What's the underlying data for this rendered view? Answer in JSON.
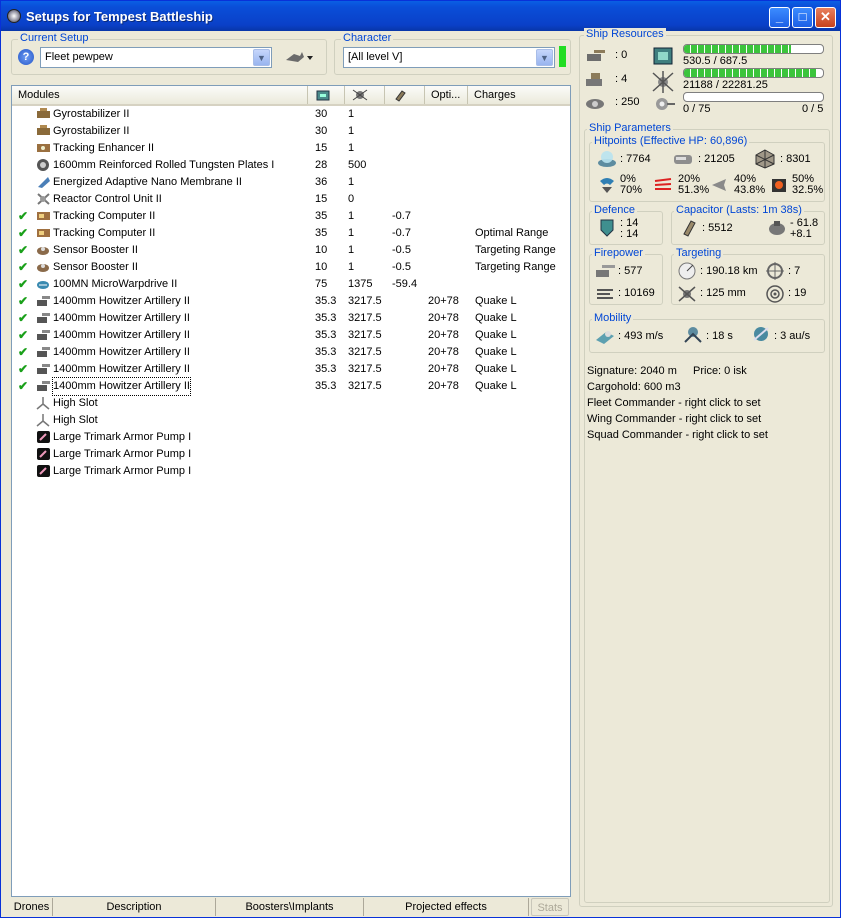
{
  "window": {
    "title": "Setups for Tempest Battleship"
  },
  "current_setup": {
    "label": "Current Setup",
    "value": "Fleet pewpew"
  },
  "character": {
    "label": "Character",
    "value": "[All level V]"
  },
  "modules": {
    "headers": [
      "Modules",
      "",
      "",
      "",
      "Opti...",
      "Charges"
    ],
    "rows": [
      {
        "check": false,
        "icon": "gyrostabilizer-icon",
        "name": "Gyrostabilizer II",
        "c1": "30",
        "c2": "1",
        "c3": "",
        "c4": "",
        "c5": ""
      },
      {
        "check": false,
        "icon": "gyrostabilizer-icon",
        "name": "Gyrostabilizer II",
        "c1": "30",
        "c2": "1",
        "c3": "",
        "c4": "",
        "c5": ""
      },
      {
        "check": false,
        "icon": "tracking-enhancer-icon",
        "name": "Tracking Enhancer II",
        "c1": "15",
        "c2": "1",
        "c3": "",
        "c4": "",
        "c5": ""
      },
      {
        "check": false,
        "icon": "armor-plate-icon",
        "name": "1600mm Reinforced Rolled Tungsten Plates I",
        "c1": "28",
        "c2": "500",
        "c3": "",
        "c4": "",
        "c5": ""
      },
      {
        "check": false,
        "icon": "membrane-icon",
        "name": "Energized Adaptive Nano Membrane II",
        "c1": "36",
        "c2": "1",
        "c3": "",
        "c4": "",
        "c5": ""
      },
      {
        "check": false,
        "icon": "reactor-icon",
        "name": "Reactor Control Unit II",
        "c1": "15",
        "c2": "0",
        "c3": "",
        "c4": "",
        "c5": ""
      },
      {
        "check": true,
        "icon": "tracking-computer-icon",
        "name": "Tracking Computer II",
        "c1": "35",
        "c2": "1",
        "c3": "-0.7",
        "c4": "",
        "c5": ""
      },
      {
        "check": true,
        "icon": "tracking-computer-icon",
        "name": "Tracking Computer II",
        "c1": "35",
        "c2": "1",
        "c3": "-0.7",
        "c4": "",
        "c5": "Optimal Range"
      },
      {
        "check": true,
        "icon": "sensor-booster-icon",
        "name": "Sensor Booster II",
        "c1": "10",
        "c2": "1",
        "c3": "-0.5",
        "c4": "",
        "c5": "Targeting Range"
      },
      {
        "check": true,
        "icon": "sensor-booster-icon",
        "name": "Sensor Booster II",
        "c1": "10",
        "c2": "1",
        "c3": "-0.5",
        "c4": "",
        "c5": "Targeting Range"
      },
      {
        "check": true,
        "icon": "microwarpdrive-icon",
        "name": "100MN MicroWarpdrive II",
        "c1": "75",
        "c2": "1375",
        "c3": "-59.4",
        "c4": "",
        "c5": ""
      },
      {
        "check": true,
        "icon": "artillery-icon",
        "name": "1400mm Howitzer Artillery II",
        "c1": "35.3",
        "c2": "3217.5",
        "c3": "",
        "c4": "20+78",
        "c5": "Quake L"
      },
      {
        "check": true,
        "icon": "artillery-icon",
        "name": "1400mm Howitzer Artillery II",
        "c1": "35.3",
        "c2": "3217.5",
        "c3": "",
        "c4": "20+78",
        "c5": "Quake L"
      },
      {
        "check": true,
        "icon": "artillery-icon",
        "name": "1400mm Howitzer Artillery II",
        "c1": "35.3",
        "c2": "3217.5",
        "c3": "",
        "c4": "20+78",
        "c5": "Quake L"
      },
      {
        "check": true,
        "icon": "artillery-icon",
        "name": "1400mm Howitzer Artillery II",
        "c1": "35.3",
        "c2": "3217.5",
        "c3": "",
        "c4": "20+78",
        "c5": "Quake L"
      },
      {
        "check": true,
        "icon": "artillery-icon",
        "name": "1400mm Howitzer Artillery II",
        "c1": "35.3",
        "c2": "3217.5",
        "c3": "",
        "c4": "20+78",
        "c5": "Quake L"
      },
      {
        "check": true,
        "icon": "artillery-icon",
        "name": "1400mm Howitzer Artillery II",
        "c1": "35.3",
        "c2": "3217.5",
        "c3": "",
        "c4": "20+78",
        "c5": "Quake L"
      },
      {
        "check": false,
        "icon": "high-slot-icon",
        "name": "High Slot",
        "c1": "",
        "c2": "",
        "c3": "",
        "c4": "",
        "c5": ""
      },
      {
        "check": false,
        "icon": "high-slot-icon",
        "name": "High Slot",
        "c1": "",
        "c2": "",
        "c3": "",
        "c4": "",
        "c5": ""
      },
      {
        "check": false,
        "icon": "rig-icon",
        "name": "Large Trimark Armor Pump I",
        "c1": "",
        "c2": "",
        "c3": "",
        "c4": "",
        "c5": ""
      },
      {
        "check": false,
        "icon": "rig-icon",
        "name": "Large Trimark Armor Pump I",
        "c1": "",
        "c2": "",
        "c3": "",
        "c4": "",
        "c5": ""
      },
      {
        "check": false,
        "icon": "rig-icon",
        "name": "Large Trimark Armor Pump I",
        "c1": "",
        "c2": "",
        "c3": "",
        "c4": "",
        "c5": ""
      }
    ]
  },
  "bottom_tabs": [
    "Drones",
    "Description",
    "Boosters\\Implants",
    "Projected effects",
    "Stats"
  ],
  "ship_resources": {
    "label": "Ship Resources",
    "turret_slots": ": 0",
    "launcher_slots": ": 4",
    "drone_bandwidth": ": 250",
    "cpu_text": "530.5 / 687.5",
    "cpu_fraction": 0.77,
    "powergrid_text": "21188 / 22281.25",
    "powergrid_fraction": 0.95,
    "calibration_text": "0 / 75",
    "calibration_fraction": 0,
    "rigs_text": "0 / 5"
  },
  "ship_parameters": {
    "label": "Ship Parameters",
    "hitpoints_label": "Hitpoints (Effective HP: 60,896)",
    "shield_hp": ": 7764",
    "armor_hp": ": 21205",
    "structure_hp": ": 8301",
    "resists": [
      {
        "a": "0%",
        "b": "70%"
      },
      {
        "a": "20%",
        "b": "51.3%"
      },
      {
        "a": "40%",
        "b": "43.8%"
      },
      {
        "a": "50%",
        "b": "32.5%"
      }
    ],
    "defence_label": "Defence",
    "defence_a": ": 14",
    "defence_b": ": 14",
    "capacitor_label": "Capacitor (Lasts: 1m 38s)",
    "capacitor_value": ": 5512",
    "capacitor_delta_a": "- 61.8",
    "capacitor_delta_b": "+8.1",
    "firepower_label": "Firepower",
    "firepower_dps": ": 577",
    "firepower_volley": ": 10169",
    "targeting_label": "Targeting",
    "targeting_range": ": 190.18 km",
    "max_targets": ": 7",
    "scan_resolution": ": 125 mm",
    "sensor_strength": ": 19",
    "mobility_label": "Mobility",
    "velocity": ": 493 m/s",
    "align_time": ": 18 s",
    "warp_speed": ": 3 au/s",
    "signature": "Signature: 2040 m",
    "price": "Price: 0 isk",
    "cargohold": "Cargohold: 600 m3",
    "fleet_commander": "Fleet Commander - right click to set",
    "wing_commander": "Wing Commander - right click to set",
    "squad_commander": "Squad Commander - right click to set"
  },
  "colors": {
    "accent": "#0046d5",
    "bar_fill": "#3cc43c",
    "check": "#1aa01a"
  }
}
